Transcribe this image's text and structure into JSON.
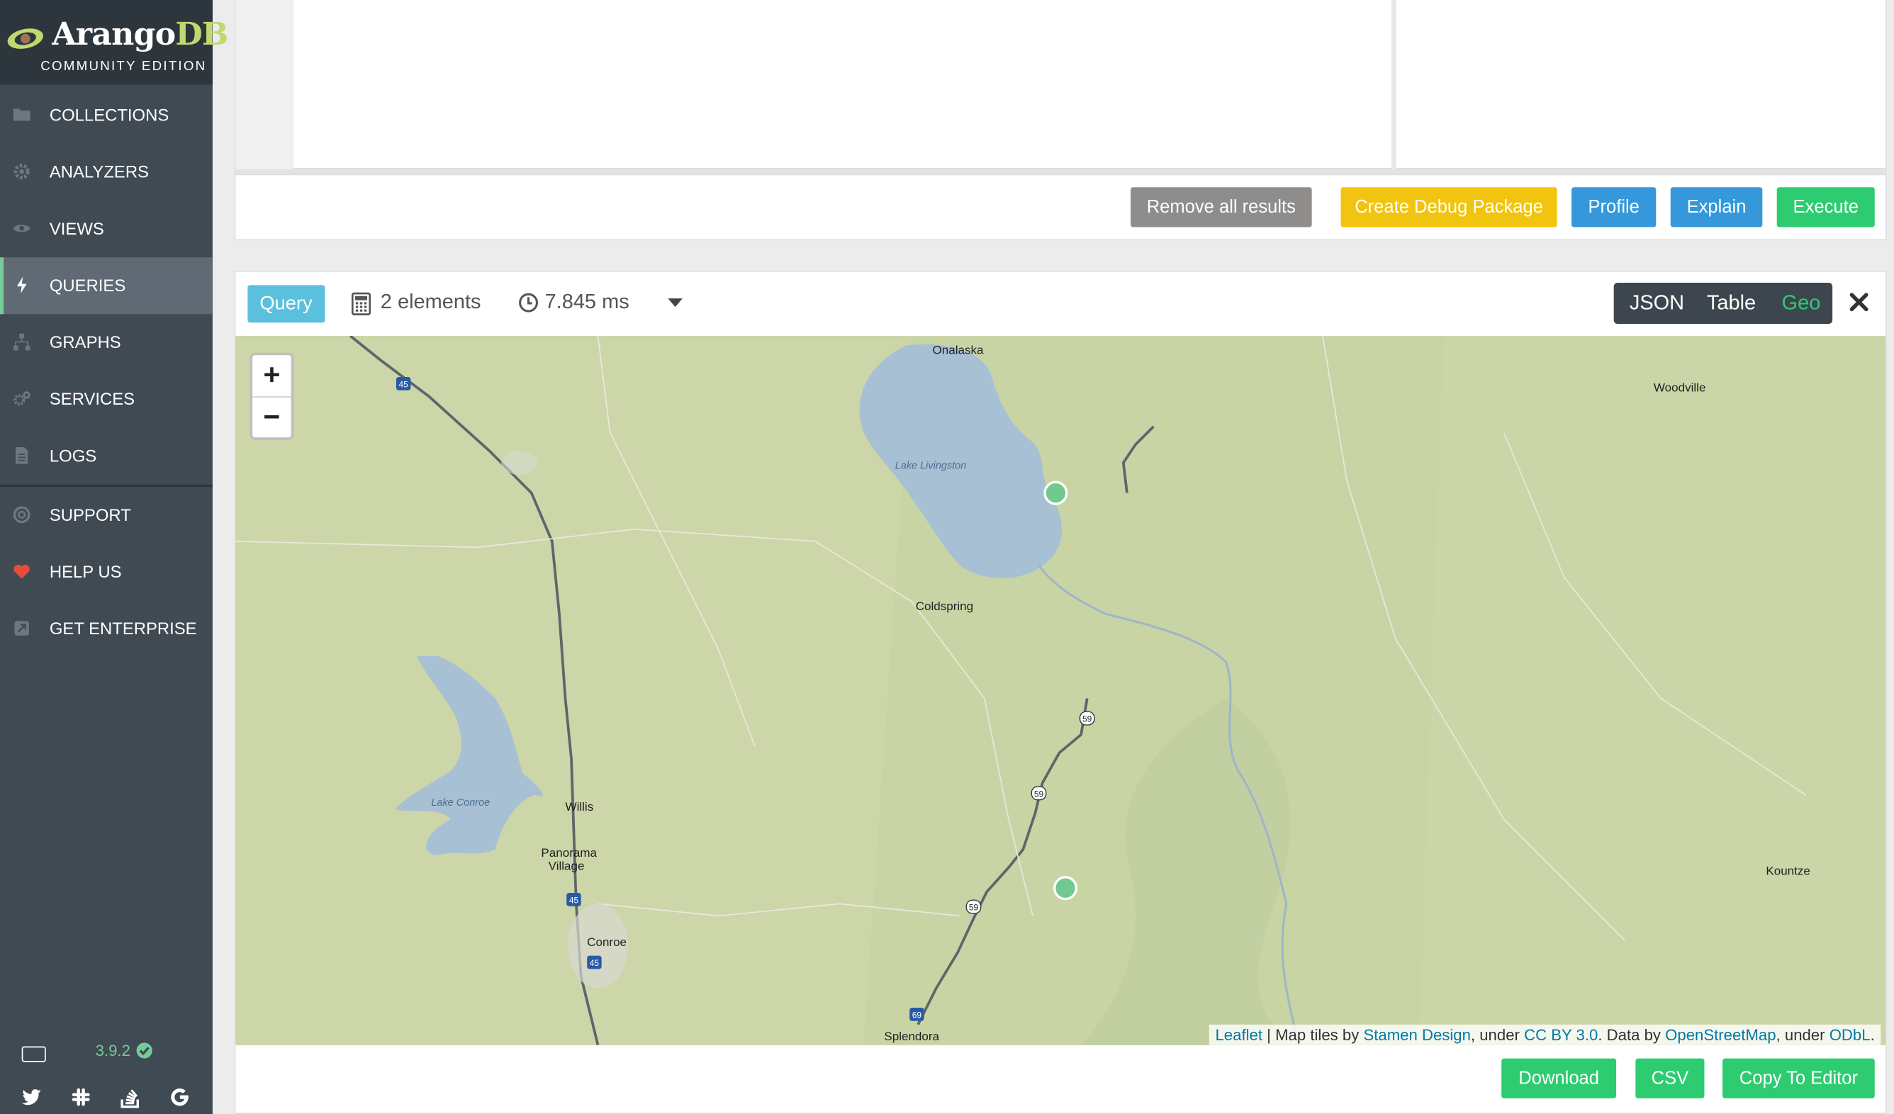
{
  "brand": {
    "name_main": "Arango",
    "name_accent": "DB",
    "edition": "COMMUNITY EDITION"
  },
  "nav": {
    "items": [
      {
        "label": "COLLECTIONS"
      },
      {
        "label": "ANALYZERS"
      },
      {
        "label": "VIEWS"
      },
      {
        "label": "QUERIES"
      },
      {
        "label": "GRAPHS"
      },
      {
        "label": "SERVICES"
      },
      {
        "label": "LOGS"
      }
    ],
    "extra": [
      {
        "label": "SUPPORT"
      },
      {
        "label": "HELP US"
      },
      {
        "label": "GET ENTERPRISE"
      }
    ],
    "active": "QUERIES"
  },
  "footer": {
    "version": "3.9.2"
  },
  "actions": {
    "remove": "Remove all results",
    "debug": "Create Debug Package",
    "profile": "Profile",
    "explain": "Explain",
    "execute": "Execute"
  },
  "result": {
    "tag": "Query",
    "elements": "2 elements",
    "time": "7.845 ms",
    "views": {
      "json": "JSON",
      "table": "Table",
      "geo": "Geo",
      "active": "Geo"
    }
  },
  "map": {
    "zoom_in": "+",
    "zoom_out": "−",
    "labels": {
      "onalaska": "Onalaska",
      "woodville": "Woodville",
      "lake_livingston": "Lake Livingston",
      "coldspring": "Coldspring",
      "willis": "Willis",
      "lake_conroe": "Lake Conroe",
      "panorama": "Panorama",
      "village": "Village",
      "conroe": "Conroe",
      "kountze": "Kountze",
      "splendora": "Splendora"
    },
    "shields": {
      "i45": "45",
      "us59": "59",
      "us69": "69"
    },
    "attribution": {
      "leaflet": "Leaflet",
      "sep": " | Map tiles by ",
      "stamen": "Stamen Design",
      "under1": ", under ",
      "ccby": "CC BY 3.0",
      "data_by": ". Data by ",
      "osm": "OpenStreetMap",
      "under2": ", under ",
      "odbl": "ODbL",
      "end": "."
    }
  },
  "result_actions": {
    "download": "Download",
    "csv": "CSV",
    "copy": "Copy To Editor"
  },
  "colors": {
    "sidebar": "#404a53",
    "brand_bg": "#2e363d",
    "accent_green": "#2ecc71",
    "blue": "#3498db",
    "yellow": "#f1c40f",
    "gray": "#8f8d8c",
    "marker": "#70c98e"
  },
  "icons": [
    "folder-icon",
    "cog-icon",
    "eye-icon",
    "bolt-icon",
    "sitemap-icon",
    "cogs-icon",
    "file-icon",
    "support-icon",
    "heart-icon",
    "enterprise-icon",
    "calculator-icon",
    "clock-icon",
    "close-icon",
    "keyboard-icon",
    "check-circle-icon",
    "twitter-icon",
    "slack-icon",
    "stackoverflow-icon",
    "google-icon"
  ]
}
